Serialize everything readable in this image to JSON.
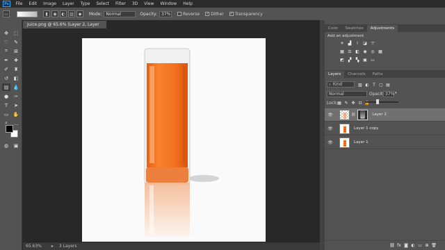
{
  "menu": [
    "File",
    "Edit",
    "Image",
    "Layer",
    "Type",
    "Select",
    "Filter",
    "3D",
    "View",
    "Window",
    "Help"
  ],
  "app_logo": "Ps",
  "options": {
    "mode_label": "Mode:",
    "mode_value": "Normal",
    "opacity_label": "Opacity:",
    "opacity_value": "37%",
    "reverse_label": "Reverse",
    "dither_label": "Dither",
    "transparency_label": "Transparency"
  },
  "document": {
    "tab_title": "Juice.png @ 65.6% (Layer 2, Layer Mask/8) *",
    "zoom": "65.63%",
    "status": "3 Layers"
  },
  "panels": {
    "top_tabs": [
      "Color",
      "Swatches",
      "Adjustments"
    ],
    "active_top_tab": "Adjustments",
    "adjust_hint": "Add an adjustment",
    "layer_tabs": [
      "Layers",
      "Channels",
      "Paths"
    ],
    "active_layer_tab": "Layers",
    "kind_label": "Kind",
    "blend_mode": "Normal",
    "opacity_label": "Opacity:",
    "opacity_value": "37%",
    "lock_label": "Lock:",
    "layers": [
      {
        "name": "Layer 2",
        "selected": true,
        "has_mask": true
      },
      {
        "name": "Layer 1 copy",
        "selected": false,
        "has_mask": false
      },
      {
        "name": "Layer 1",
        "selected": false,
        "has_mask": false
      }
    ]
  },
  "colors": {
    "juice": "#f26d1d",
    "juice_dark": "#e05a10",
    "selection": "#707070",
    "brand": "#31a8ff"
  }
}
